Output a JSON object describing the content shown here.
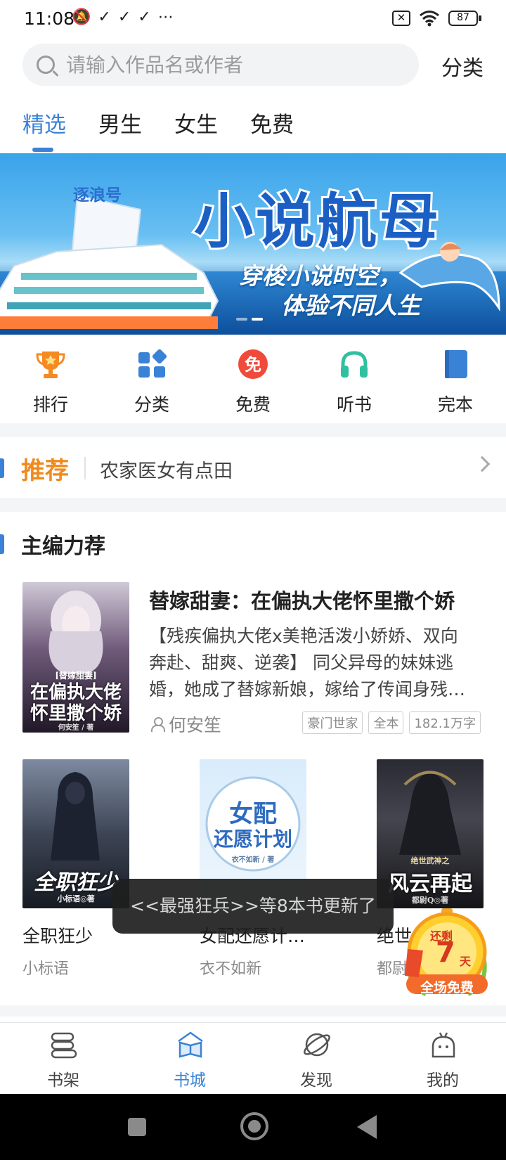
{
  "status_bar": {
    "time": "11:08",
    "left_icons": "🔕✓✓✓⋯",
    "sim_icon": "✕",
    "battery": "87"
  },
  "search": {
    "placeholder": "请输入作品名或作者",
    "category_label": "分类"
  },
  "tabs": [
    {
      "label": "精选",
      "active": true
    },
    {
      "label": "男生",
      "active": false
    },
    {
      "label": "女生",
      "active": false
    },
    {
      "label": "免费",
      "active": false
    }
  ],
  "banner": {
    "ship_name": "逐浪号",
    "title": "小说航母",
    "subtitle_line1": "穿梭小说时空，",
    "subtitle_line2": "体验不同人生",
    "slide_count": 2,
    "active_slide": 2
  },
  "quick_entries": [
    {
      "label": "排行",
      "icon": "trophy-icon"
    },
    {
      "label": "分类",
      "icon": "category-grid-icon"
    },
    {
      "label": "免费",
      "icon": "free-badge-icon"
    },
    {
      "label": "听书",
      "icon": "headphones-icon"
    },
    {
      "label": "完本",
      "icon": "book-icon"
    }
  ],
  "quick_free_glyph": "免",
  "recommend": {
    "title": "推荐",
    "text": "农家医女有点田"
  },
  "editors_pick": {
    "title": "主编力荐",
    "featured": {
      "title": "替嫁甜妻：在偏执大佬怀里撒个娇",
      "description": "【残疾偏执大佬x美艳活泼小娇娇、双向奔赴、甜爽、逆袭】 同父异母的妹妹逃婚，她成了替嫁新娘，嫁给了传闻身残…",
      "author": "何安笙",
      "tags": [
        "豪门世家",
        "全本",
        "182.1万字"
      ],
      "cover_small": "[替嫁甜妻]",
      "cover_line1": "在偏执大佬",
      "cover_line2": "怀里撒个娇",
      "cover_author": "何安笙 / 著"
    },
    "books": [
      {
        "title": "全职狂少",
        "author": "小标语",
        "cover_text": "全职狂少",
        "cover_author": "小标语◎著"
      },
      {
        "title": "女配还愿计…",
        "author": "衣不如新",
        "cover_line1": "女配",
        "cover_line2": "还愿计划",
        "cover_author": "衣不如新 / 著"
      },
      {
        "title": "绝世",
        "author": "都尉",
        "cover_small": "绝世武神之",
        "cover_text": "风云再起",
        "cover_author": "都尉Q◎著"
      }
    ]
  },
  "toast": "<<最强狂兵>>等8本书更新了",
  "promo": {
    "line1": "还剩",
    "days": "7",
    "unit": "天",
    "line2": "全场免费"
  },
  "bottom_nav": [
    {
      "label": "书架",
      "icon": "bookshelf-icon",
      "active": false
    },
    {
      "label": "书城",
      "icon": "bookstore-icon",
      "active": true
    },
    {
      "label": "发现",
      "icon": "planet-icon",
      "active": false
    },
    {
      "label": "我的",
      "icon": "profile-icon",
      "active": false
    }
  ],
  "colors": {
    "accent": "#3a82d6",
    "recommend": "#f08a1e",
    "free_red": "#f04a3a",
    "headphones_green": "#2fc0a0"
  }
}
